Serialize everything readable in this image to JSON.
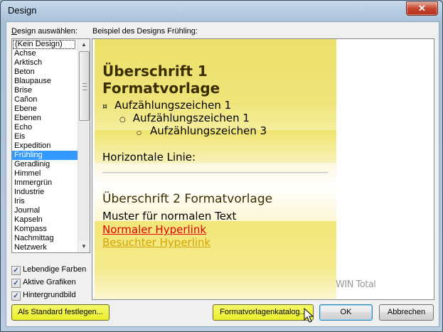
{
  "window": {
    "title": "Design",
    "close_glyph": "✕"
  },
  "labels": {
    "list_label": "Design auswählen:",
    "list_label_mnemonic": "D",
    "list_label_rest": "esign auswählen:",
    "preview_label": "Beispiel des Designs Frühling:"
  },
  "design_list": {
    "items": [
      "(Kein Design)",
      "Achse",
      "Arktisch",
      "Beton",
      "Blaupause",
      "Brise",
      "Cañon",
      "Ebene",
      "Ebenen",
      "Echo",
      "Eis",
      "Expedition",
      "Frühling",
      "Geradlinig",
      "Himmel",
      "Immergrün",
      "Industrie",
      "Iris",
      "Journal",
      "Kapseln",
      "Kompass",
      "Nachmittag",
      "Netzwerk"
    ],
    "selected": "Frühling"
  },
  "options": [
    {
      "label": "Lebendige Farben",
      "checked": true
    },
    {
      "label": "Aktive Grafiken",
      "checked": true
    },
    {
      "label": "Hintergrundbild",
      "checked": true
    }
  ],
  "preview": {
    "heading1": "Überschrift 1 Formatvorlage",
    "heading1_line1": "Überschrift 1",
    "heading1_line2": "Formatvorlage",
    "bullet1": "Aufzählungszeichen 1",
    "bullet2": "Aufzählungszeichen 1",
    "bullet3": "Aufzählungszeichen 3",
    "hr_label": "Horizontale Linie:",
    "heading2": "Überschrift 2 Formatvorlage",
    "normal_text": "Muster für normalen Text",
    "hyperlink": "Normaler Hyperlink",
    "visited_hyperlink": "Besuchter Hyperlink",
    "watermark": "WIN Total"
  },
  "buttons": {
    "set_default": "Als Standard festlegen...",
    "catalog": "Formatvorlagenkatalog...",
    "ok": "OK",
    "cancel": "Abbrechen"
  },
  "colors": {
    "accent_yellow": "#e8dc5a",
    "heading_color": "#3a2e00",
    "hyperlink": "#e00000",
    "visited_hyperlink": "#d8a400",
    "selection": "#3399ff"
  }
}
